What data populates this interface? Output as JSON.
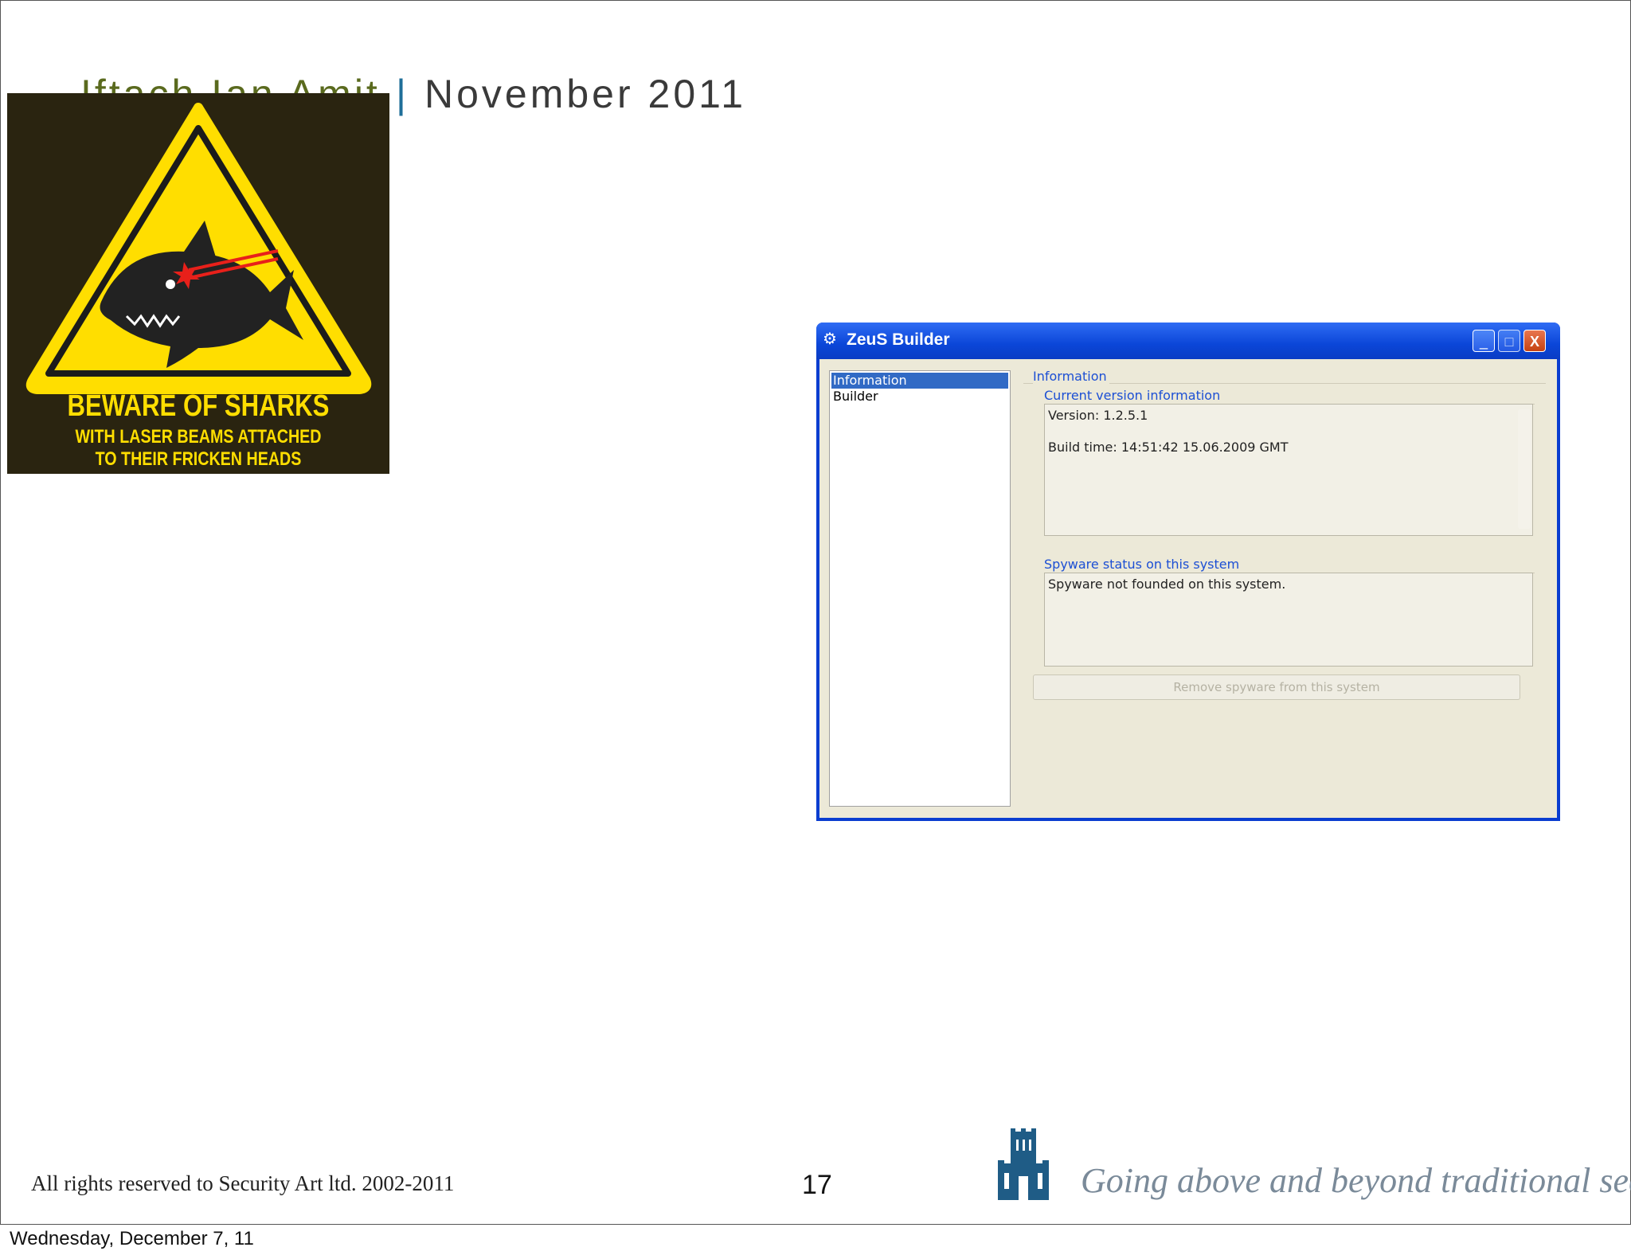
{
  "header": {
    "author": "Iftach Ian Amit",
    "separator": "|",
    "date": "November 2011"
  },
  "shark_sign": {
    "line1": "BEWARE OF SHARKS",
    "line2": "WITH LASER BEAMS ATTACHED",
    "line3": "TO THEIR FRICKEN HEADS"
  },
  "window": {
    "title": "ZeuS Builder",
    "controls": {
      "minimize": "_",
      "maximize": "□",
      "close": "X"
    },
    "nav": [
      "Information",
      "Builder"
    ],
    "section_title": "Information",
    "version_group": {
      "label": "Current version information",
      "version": "Version: 1.2.5.1",
      "build_time": "Build time: 14:51:42 15.06.2009 GMT"
    },
    "spyware_group": {
      "label": "Spyware status on this system",
      "status": "Spyware not founded on this system."
    },
    "remove_button": "Remove spyware from this system"
  },
  "footer": {
    "copyright": "All rights reserved to Security Art ltd. 2002-2011",
    "page_number": "17",
    "tagline": "Going above and beyond traditional security",
    "slide_date": "Wednesday, December 7, 11"
  },
  "colors": {
    "sign_yellow": "#ffde00",
    "titlebar_blue": "#0b46d8",
    "link_blue": "#1c4fd4"
  }
}
